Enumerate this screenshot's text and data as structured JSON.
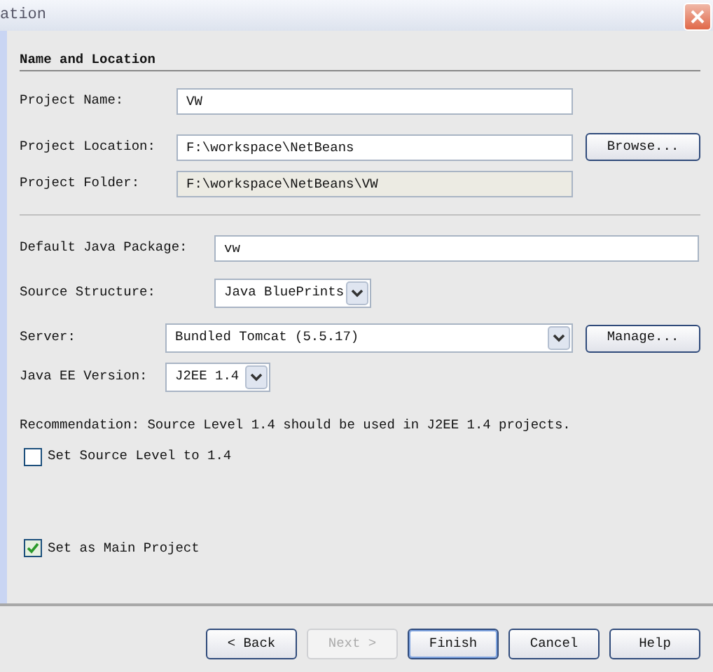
{
  "window": {
    "title": "ation"
  },
  "section": {
    "title": "Name and Location"
  },
  "location_fields": [
    {
      "kind": "text",
      "label": "Project Name:",
      "value": "VW"
    },
    {
      "kind": "text",
      "label": "Project Location:",
      "value": "F:\\workspace\\NetBeans",
      "button": "Browse..."
    },
    {
      "kind": "readonly",
      "label": "Project Folder:",
      "value": "F:\\workspace\\NetBeans\\VW"
    }
  ],
  "settings_fields": [
    {
      "kind": "text",
      "label": "Default Java Package:",
      "value": "vw"
    },
    {
      "kind": "combo",
      "label": "Source Structure:",
      "value": "Java BluePrints"
    },
    {
      "kind": "combo",
      "label": "Server:",
      "value": "Bundled Tomcat (5.5.17)",
      "button": "Manage..."
    },
    {
      "kind": "combo",
      "label": "Java EE Version:",
      "value": "J2EE 1.4"
    }
  ],
  "recommendation": "Recommendation: Source Level 1.4 should be used in J2EE 1.4 projects.",
  "checkboxes": [
    {
      "label": "Set Source Level to 1.4",
      "checked": false
    },
    {
      "label": "Set as Main Project",
      "checked": true
    }
  ],
  "buttons": [
    {
      "label": "< Back",
      "disabled": false,
      "selected": false
    },
    {
      "label": "Next >",
      "disabled": true,
      "selected": false
    },
    {
      "label": "Finish",
      "disabled": false,
      "selected": true
    },
    {
      "label": "Cancel",
      "disabled": false,
      "selected": false
    },
    {
      "label": "Help",
      "disabled": false,
      "selected": false
    }
  ]
}
